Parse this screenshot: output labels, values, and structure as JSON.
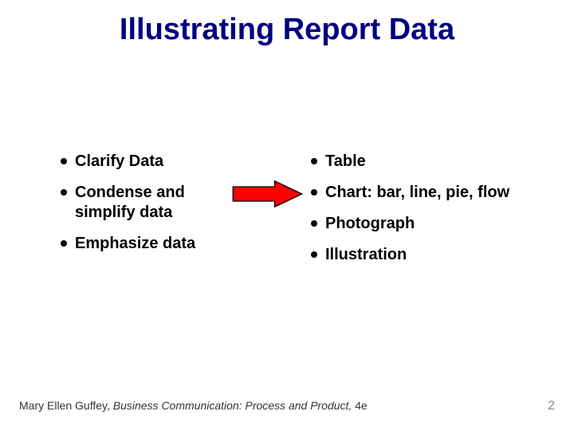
{
  "title": "Illustrating Report Data",
  "left_bullets": [
    "Clarify Data",
    "Condense and simplify data",
    "Emphasize data"
  ],
  "right_bullets": [
    "Table",
    "Chart: bar, line, pie, flow",
    "Photograph",
    "Illustration"
  ],
  "arrow": {
    "fill": "#ff0000",
    "stroke": "#000000"
  },
  "footer": {
    "author": "Mary Ellen Guffey, ",
    "book": "Business Communication: Process and Product, ",
    "edition": "4e"
  },
  "page_number": "2"
}
